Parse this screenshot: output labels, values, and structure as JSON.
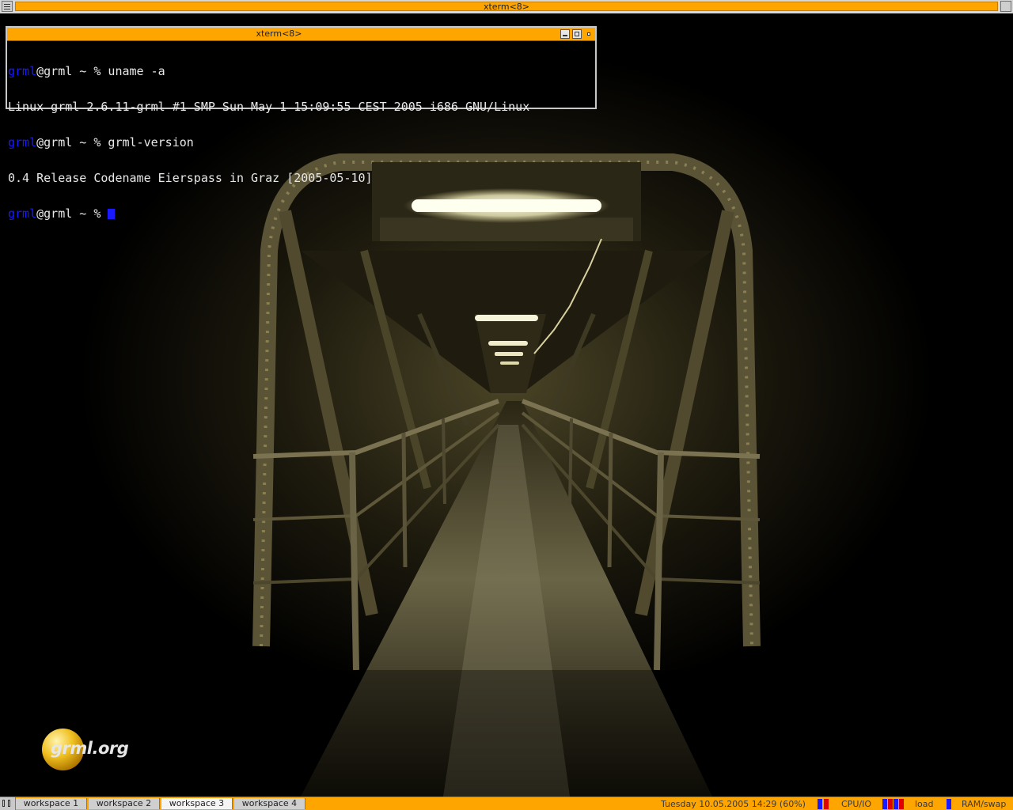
{
  "top_bar": {
    "title": "xterm<8>"
  },
  "xterm": {
    "title": "xterm<8>",
    "lines": [
      {
        "user": "grml",
        "rest": "@grml ~ % uname -a"
      },
      {
        "user": "",
        "rest": "Linux grml 2.6.11-grml #1 SMP Sun May 1 15:09:55 CEST 2005 i686 GNU/Linux"
      },
      {
        "user": "grml",
        "rest": "@grml ~ % grml-version"
      },
      {
        "user": "",
        "rest": "0.4 Release Codename Eierspass in Graz [2005-05-10]"
      },
      {
        "user": "grml",
        "rest": "@grml ~ % "
      }
    ]
  },
  "logo": {
    "text": "grml.org"
  },
  "bottom_bar": {
    "workspaces": [
      {
        "label": "workspace 1",
        "active": false
      },
      {
        "label": "workspace 2",
        "active": false
      },
      {
        "label": "workspace 3",
        "active": true
      },
      {
        "label": "workspace 4",
        "active": false
      }
    ],
    "datetime": "Tuesday 10.05.2005 14:29 (60%)",
    "cpu_label": "CPU/IO",
    "load_label": "load",
    "ram_label": "RAM/swap"
  },
  "colors": {
    "accent": "#ffa500",
    "prompt_user": "#1a1aff",
    "meter_blue": "#1a1aff",
    "meter_red": "#e00000"
  }
}
